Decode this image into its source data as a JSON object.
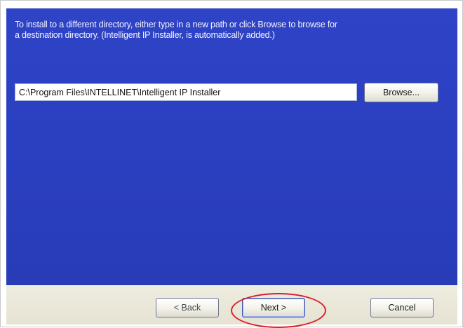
{
  "instructions": "To install to a different directory, either type in a new path or click Browse to browse for\na destination directory. (Intelligent IP Installer, is automatically added.)",
  "path_input": {
    "value": "C:\\Program Files\\INTELLINET\\Intelligent IP Installer"
  },
  "buttons": {
    "browse": "Browse...",
    "back": "< Back",
    "next": "Next >",
    "cancel": "Cancel"
  },
  "colors": {
    "panel_blue": "#2b3ec0",
    "highlight_red": "#d8202a"
  }
}
